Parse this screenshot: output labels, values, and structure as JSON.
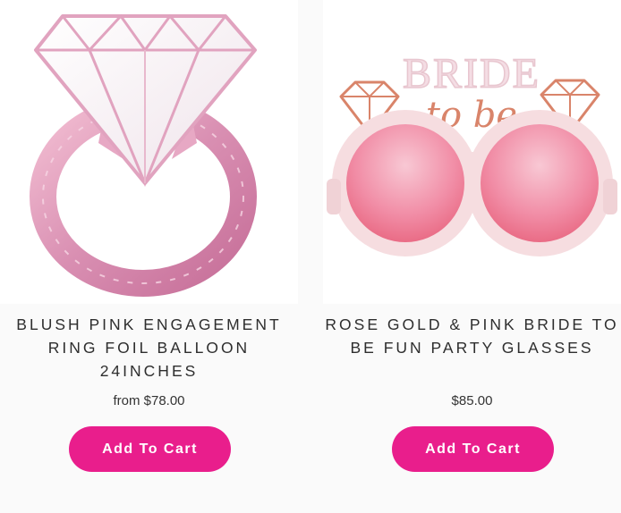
{
  "products": [
    {
      "title_line1": "BLUSH PINK ENGAGEMENT",
      "title_line2": "RING FOIL BALLOON",
      "title_line3": "24INCHES",
      "price": "from $78.00",
      "button_label": "Add To Cart",
      "image_icon": "ring-balloon-image"
    },
    {
      "title_line1": "ROSE GOLD & PINK BRIDE TO",
      "title_line2": "BE FUN PARTY GLASSES",
      "title_line3": "",
      "price": "$85.00",
      "button_label": "Add To Cart",
      "image_icon": "bride-glasses-image",
      "image_text_bride": "BRIDE",
      "image_text_tobe": "to be"
    }
  ],
  "colors": {
    "button": "#e91e8c",
    "background": "#fafafa",
    "text": "#2e2e2e"
  }
}
